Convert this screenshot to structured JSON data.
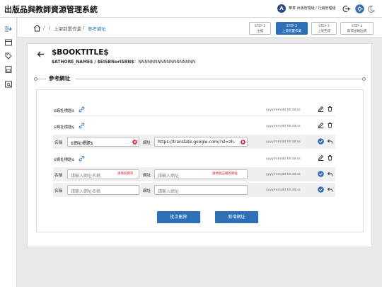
{
  "app": {
    "title": "出版品與教師資源管理系統",
    "user_initial": "A",
    "user_name": "華泰 出版管理組 / 行銷管理組"
  },
  "breadcrumb": {
    "sep1": "/",
    "sep2": "/",
    "item1": "上架前置作業",
    "sep3": "/",
    "item2": "參考網址"
  },
  "steps": [
    {
      "num": "STEP 1",
      "name": "主檔"
    },
    {
      "num": "STEP 2",
      "name": "上架前置作業"
    },
    {
      "num": "STEP 3",
      "name": "上架完成"
    },
    {
      "num": "STEP 4",
      "name": "取得並輸出網"
    }
  ],
  "book": {
    "title": "$BOOKTITLE$",
    "authors_label": "$ATHORE_NAME$ / $EISBNorISBN$",
    "isbn_suffix": "：NNNNNNNNNNNNNNNNNN"
  },
  "section": {
    "title": "參考網址"
  },
  "url_rows": [
    {
      "label": "$網址標題$",
      "date": "yyyy/mm/dd hh:dd:ss"
    },
    {
      "label": "$網址標題$",
      "date": "yyyy/mm/dd hh:dd:ss"
    },
    {
      "label": "$網址標題$",
      "date": "yyyy/mm/dd hh:dd:ss"
    }
  ],
  "edit_rows": [
    {
      "name_label": "名稱",
      "name_value": "$網址標題$",
      "url_label": "網址",
      "url_value": "https://translate.google.com/?sl=zh-",
      "date": "yyyy/mm/dd hh:dd:ss"
    },
    {
      "name_label": "名稱",
      "name_placeholder": "請輸入網址名稱",
      "name_error": "請填寫資料",
      "url_label": "網址",
      "url_placeholder": "請輸入網址",
      "url_error": "請填寫正確的網址",
      "date": "yyyy/mm/dd hh:dd:ss"
    },
    {
      "name_label": "名稱",
      "name_placeholder": "請輸入網址名稱",
      "url_label": "網址",
      "url_placeholder": "請輸入網址",
      "date": "yyyy/mm/dd hh:dd:ss"
    }
  ],
  "buttons": {
    "batch_delete": "批次刪除",
    "add_url": "新增網址"
  },
  "colors": {
    "accent": "#2f6fb5",
    "error": "#dd2233"
  }
}
